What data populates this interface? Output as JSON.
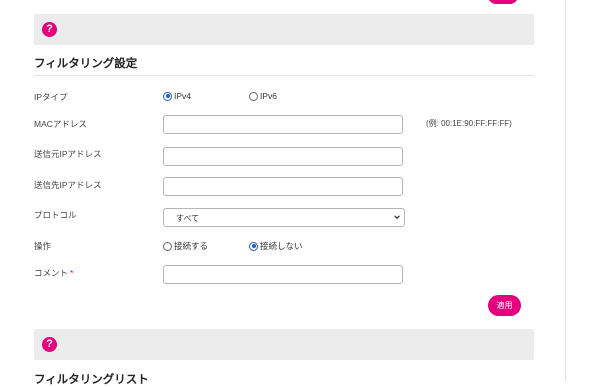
{
  "colors": {
    "accent": "#e5007e",
    "radio_checked": "#1f5fd1",
    "help_bar_bg": "#ececec"
  },
  "help_bar_1": {
    "icon": "question-mark-icon",
    "glyph": "?"
  },
  "filter_settings": {
    "title": "フィルタリング設定",
    "ip_type": {
      "label": "IPタイプ",
      "options": [
        "IPv4",
        "IPv6"
      ],
      "selected": "IPv4"
    },
    "mac_address": {
      "label": "MACアドレス",
      "value": "",
      "hint": "(例: 00:1E:90:FF:FF:FF)"
    },
    "source_ip": {
      "label": "送信元IPアドレス",
      "value": ""
    },
    "dest_ip": {
      "label": "送信先IPアドレス",
      "value": ""
    },
    "protocol": {
      "label": "プロトコル",
      "selected": "すべて"
    },
    "action": {
      "label": "操作",
      "options": [
        "接続する",
        "接続しない"
      ],
      "selected": "接続しない"
    },
    "comment": {
      "label": "コメント",
      "required_mark": "*",
      "value": ""
    },
    "apply_label": "適用"
  },
  "help_bar_2": {
    "icon": "question-mark-icon",
    "glyph": "?"
  },
  "filter_list": {
    "title": "フィルタリングリスト"
  }
}
